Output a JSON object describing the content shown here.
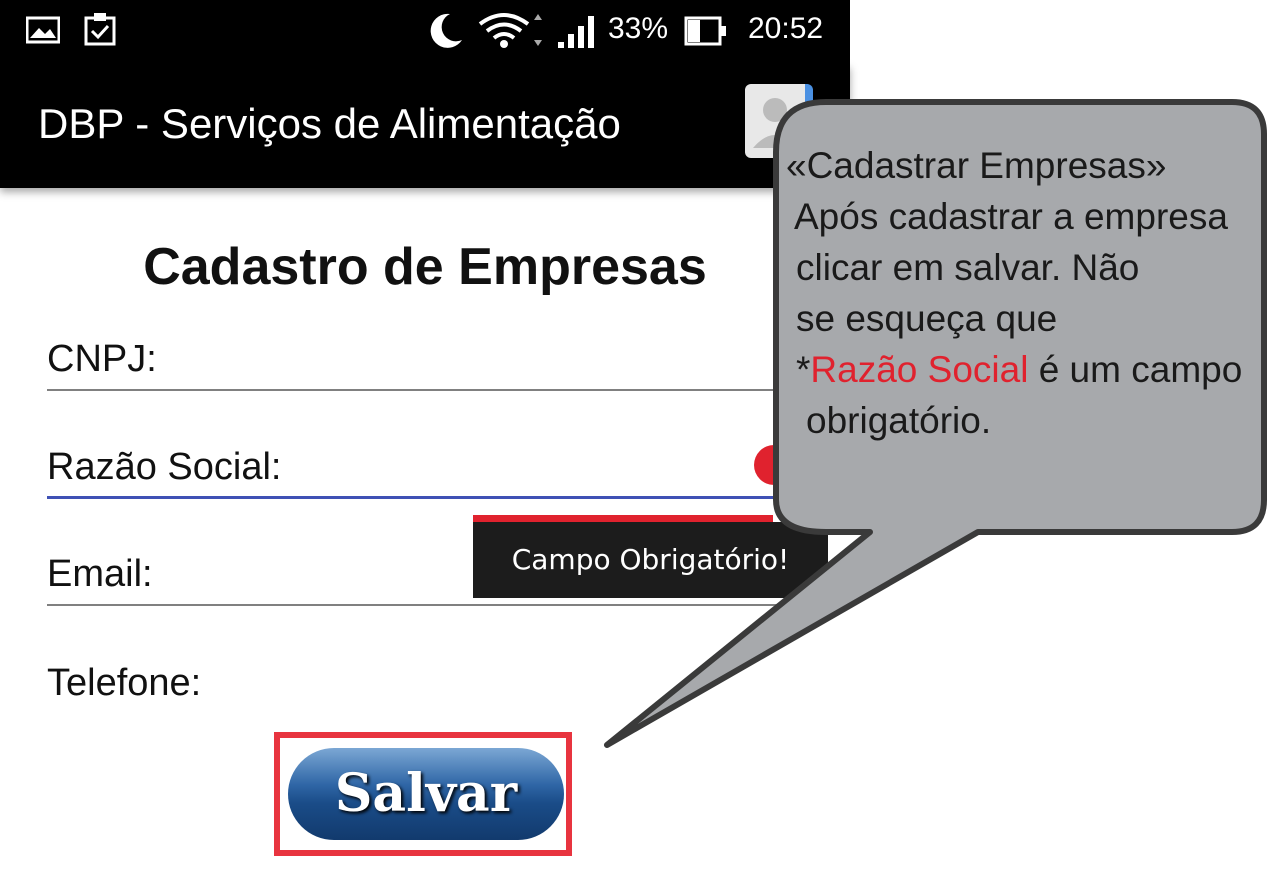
{
  "status_bar": {
    "battery": "33%",
    "time": "20:52",
    "icons": [
      "image-icon",
      "clipboard-check-icon",
      "moon-icon",
      "wifi-icon",
      "signal-icon",
      "battery-icon"
    ]
  },
  "app_bar": {
    "title": "DBP - Serviços de Alimentação",
    "avatar_icon": "contact-icon"
  },
  "form": {
    "title": "Cadastro de Empresas",
    "fields": [
      {
        "label": "CNPJ:"
      },
      {
        "label": "Razão Social:"
      },
      {
        "label": "Email:"
      },
      {
        "label": "Telefone:"
      }
    ],
    "error_tooltip": "Campo Obrigatório!",
    "save_label": "Salvar"
  },
  "callout": {
    "line1": "«Cadastrar Empresas»",
    "line2": "Após cadastrar a empresa",
    "line3": "clicar  em salvar. Não",
    "line4": "se esqueça que",
    "line5_prefix": "*",
    "line5_highlight": "Razão Social",
    "line5_suffix": " é um campo",
    "line6": "obrigatório.",
    "fill": "#a7a9ac",
    "highlight_color": "#e0222e"
  },
  "colors": {
    "accent": "#3f51b5",
    "error": "#e0222e"
  }
}
